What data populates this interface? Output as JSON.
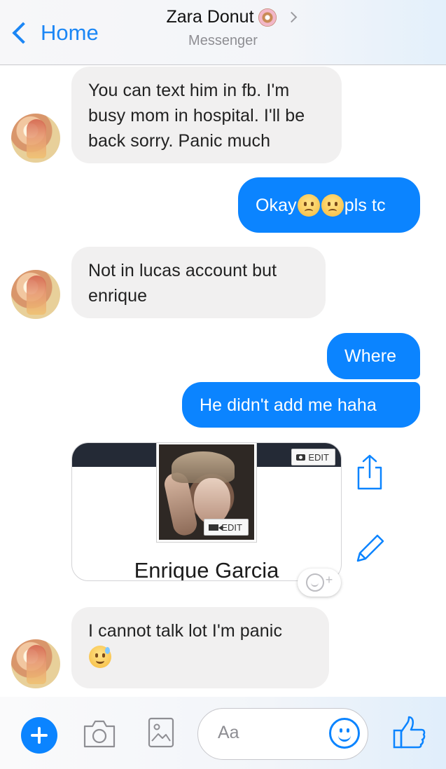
{
  "header": {
    "back_label": "Home",
    "title": "Zara Donut",
    "title_icon": "donut-icon",
    "subtitle": "Messenger"
  },
  "messages": [
    {
      "sender": "contact",
      "text": "You can text him in fb. I'm busy mom in hospital. I'll be back sorry. Panic much"
    },
    {
      "sender": "me",
      "text_before": "Okay",
      "emojis": [
        "worried-face",
        "worried-face"
      ],
      "text_after": "pls tc"
    },
    {
      "sender": "contact",
      "text": "Not in lucas account but enrique"
    },
    {
      "sender": "me",
      "text": "Where"
    },
    {
      "sender": "me",
      "text": "He didn't add me haha"
    },
    {
      "sender": "contact",
      "type": "profile-card",
      "name": "Enrique Garcia",
      "cover_edit_label": "EDIT",
      "photo_edit_label": "EDIT"
    },
    {
      "sender": "contact",
      "text": "I cannot talk lot I'm panic",
      "emoji": "grinning-face-with-sweat"
    }
  ],
  "composer": {
    "placeholder": "Aa",
    "icons": [
      "plus-icon",
      "camera-icon",
      "gallery-icon",
      "emoji-icon",
      "thumbs-up-icon"
    ]
  },
  "colors": {
    "accent": "#0b84ff",
    "received_bubble": "#f1f0f0",
    "sent_bubble": "#0b84ff"
  }
}
